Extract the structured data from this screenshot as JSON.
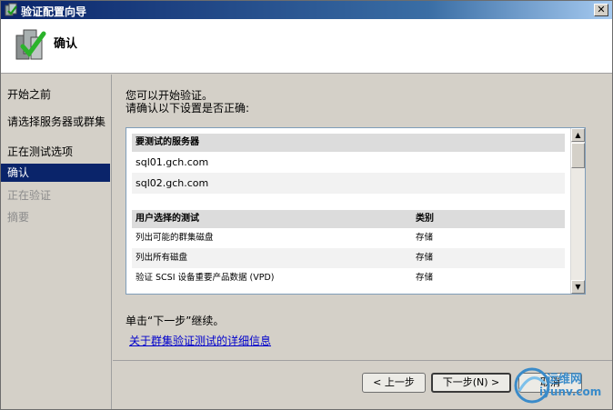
{
  "window": {
    "title": "验证配置向导",
    "close_glyph": "✕"
  },
  "header": {
    "title": "确认",
    "icon": "server-check-icon"
  },
  "nav": {
    "items": [
      {
        "label": "开始之前",
        "state": "normal"
      },
      {
        "label": "请选择服务器或群集",
        "state": "normal"
      },
      {
        "label": "正在测试选项",
        "state": "normal"
      },
      {
        "label": "确认",
        "state": "active"
      },
      {
        "label": "正在验证",
        "state": "disabled"
      },
      {
        "label": "摘要",
        "state": "disabled"
      }
    ]
  },
  "main": {
    "intro_line1": "您可以开始验证。",
    "intro_line2": "请确认以下设置是否正确:",
    "servers_header": "要测试的服务器",
    "servers": [
      "sql01.gch.com",
      "sql02.gch.com"
    ],
    "tests_header": "用户选择的测试",
    "category_header": "类别",
    "tests": [
      {
        "name": "列出可能的群集磁盘",
        "category": "存储"
      },
      {
        "name": "列出所有磁盘",
        "category": "存储"
      },
      {
        "name": "验证 SCSI 设备重要产品数据 (VPD)",
        "category": "存储"
      }
    ],
    "continue_text": "单击“下一步”继续。",
    "more_info_link": "关于群集验证测试的详细信息"
  },
  "footer": {
    "back_label": "< 上一步",
    "next_label": "下一步(N) >",
    "cancel_label": "取消"
  },
  "watermark": {
    "text1": "运维网",
    "text2": "iyunv.com"
  },
  "colors": {
    "active_nav": "#0a246a",
    "link": "#0000cc",
    "title_bar": "#0a246a"
  }
}
